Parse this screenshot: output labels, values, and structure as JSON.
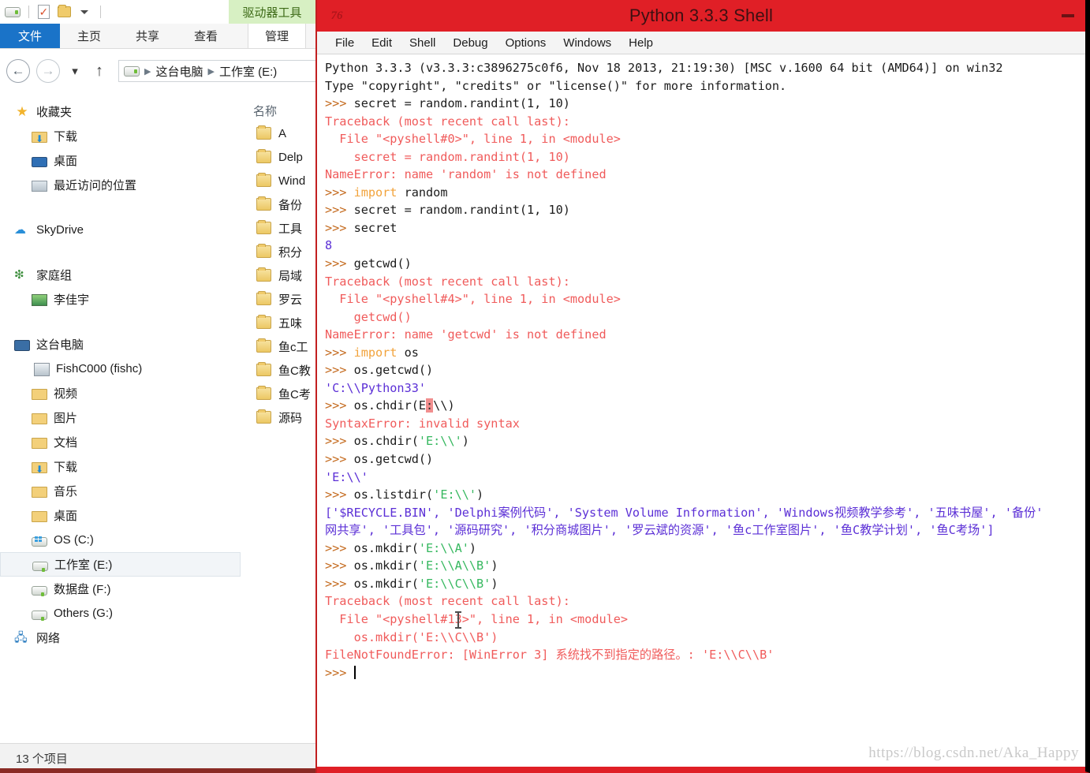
{
  "explorer": {
    "quick_access": {
      "drive_icon": "drive-icon",
      "new_doc_icon": "new-document-icon",
      "new_folder_icon": "new-folder-icon",
      "customize_icon": "chevron-down-icon"
    },
    "contextual_tab": "驱动器工具",
    "ribbon_tabs": [
      {
        "label": "文件",
        "active": true
      },
      {
        "label": "主页",
        "active": false
      },
      {
        "label": "共享",
        "active": false
      },
      {
        "label": "查看",
        "active": false
      },
      {
        "label": "管理",
        "active": false
      }
    ],
    "nav": {
      "back_icon": "back-arrow-icon",
      "forward_icon": "forward-arrow-icon",
      "history_icon": "chevron-down-icon",
      "up_icon": "up-arrow-icon",
      "breadcrumbs": [
        "这台电脑",
        "工作室 (E:)"
      ]
    },
    "tree": [
      {
        "label": "收藏夹",
        "icon": "star-icon",
        "level": 0,
        "selected": false
      },
      {
        "label": "下载",
        "icon": "folder-download-icon",
        "level": 1,
        "selected": false
      },
      {
        "label": "桌面",
        "icon": "desktop-icon",
        "level": 1,
        "selected": false
      },
      {
        "label": "最近访问的位置",
        "icon": "recent-places-icon",
        "level": 1,
        "selected": false
      },
      {
        "label": "SkyDrive",
        "icon": "cloud-icon",
        "level": 0,
        "selected": false
      },
      {
        "label": "家庭组",
        "icon": "homegroup-icon",
        "level": 0,
        "selected": false
      },
      {
        "label": "李佳宇",
        "icon": "user-icon",
        "level": 1,
        "selected": false
      },
      {
        "label": "这台电脑",
        "icon": "this-pc-icon",
        "level": 0,
        "selected": false
      },
      {
        "label": "FishC000 (fishc)",
        "icon": "device-icon",
        "level": 1,
        "selected": false
      },
      {
        "label": "视频",
        "icon": "folder-videos-icon",
        "level": 1,
        "selected": false
      },
      {
        "label": "图片",
        "icon": "folder-pictures-icon",
        "level": 1,
        "selected": false
      },
      {
        "label": "文档",
        "icon": "folder-documents-icon",
        "level": 1,
        "selected": false
      },
      {
        "label": "下载",
        "icon": "folder-download-icon",
        "level": 1,
        "selected": false
      },
      {
        "label": "音乐",
        "icon": "folder-music-icon",
        "level": 1,
        "selected": false
      },
      {
        "label": "桌面",
        "icon": "folder-desktop-icon",
        "level": 1,
        "selected": false
      },
      {
        "label": "OS (C:)",
        "icon": "os-drive-icon",
        "level": 1,
        "selected": false
      },
      {
        "label": "工作室 (E:)",
        "icon": "drive-icon",
        "level": 1,
        "selected": true
      },
      {
        "label": "数据盘 (F:)",
        "icon": "drive-icon",
        "level": 1,
        "selected": false
      },
      {
        "label": "Others (G:)",
        "icon": "drive-icon",
        "level": 1,
        "selected": false
      },
      {
        "label": "网络",
        "icon": "network-icon",
        "level": 0,
        "selected": false
      }
    ],
    "list": {
      "column_header": "名称",
      "rows": [
        {
          "name": "A",
          "icon": "folder-icon"
        },
        {
          "name": "Delp",
          "icon": "folder-icon"
        },
        {
          "name": "Wind",
          "icon": "folder-icon"
        },
        {
          "name": "备份",
          "icon": "folder-icon"
        },
        {
          "name": "工具",
          "icon": "folder-icon"
        },
        {
          "name": "积分",
          "icon": "folder-icon"
        },
        {
          "name": "局域",
          "icon": "folder-icon"
        },
        {
          "name": "罗云",
          "icon": "folder-icon"
        },
        {
          "name": "五味",
          "icon": "folder-icon"
        },
        {
          "name": "鱼c工",
          "icon": "folder-icon"
        },
        {
          "name": "鱼C教",
          "icon": "folder-icon"
        },
        {
          "name": "鱼C考",
          "icon": "folder-icon"
        },
        {
          "name": "源码",
          "icon": "folder-icon"
        }
      ]
    },
    "status": "13 个项目"
  },
  "shell": {
    "title": "Python 3.3.3 Shell",
    "logo_icon": "python-idle-icon",
    "minimize_icon": "minimize-icon",
    "titlebar_color": "#e01f26",
    "menus": [
      "File",
      "Edit",
      "Shell",
      "Debug",
      "Options",
      "Windows",
      "Help"
    ],
    "lines": [
      {
        "segments": [
          {
            "t": "Python 3.3.3 (v3.3.3:c3896275c0f6, Nov 18 2013, 21:19:30) [MSC v.1600 64 bit (AMD64)] on win32",
            "c": "out"
          }
        ]
      },
      {
        "segments": [
          {
            "t": "Type \"copyright\", \"credits\" or \"license()\" for more information.",
            "c": "out"
          }
        ]
      },
      {
        "segments": [
          {
            "t": ">>> ",
            "c": "prompt"
          },
          {
            "t": "secret = random.randint(1, 10)",
            "c": "out"
          }
        ]
      },
      {
        "segments": [
          {
            "t": "Traceback (most recent call last):",
            "c": "err"
          }
        ]
      },
      {
        "segments": [
          {
            "t": "  File \"<pyshell#0>\", line 1, in <module>",
            "c": "err"
          }
        ]
      },
      {
        "segments": [
          {
            "t": "    secret = random.randint(1, 10)",
            "c": "err"
          }
        ]
      },
      {
        "segments": [
          {
            "t": "NameError: name 'random' is not defined",
            "c": "err"
          }
        ]
      },
      {
        "segments": [
          {
            "t": ">>> ",
            "c": "prompt"
          },
          {
            "t": "import",
            "c": "kw"
          },
          {
            "t": " random",
            "c": "out"
          }
        ]
      },
      {
        "segments": [
          {
            "t": ">>> ",
            "c": "prompt"
          },
          {
            "t": "secret = random.randint(1, 10)",
            "c": "out"
          }
        ]
      },
      {
        "segments": [
          {
            "t": ">>> ",
            "c": "prompt"
          },
          {
            "t": "secret",
            "c": "out"
          }
        ]
      },
      {
        "segments": [
          {
            "t": "8",
            "c": "val"
          }
        ]
      },
      {
        "segments": [
          {
            "t": ">>> ",
            "c": "prompt"
          },
          {
            "t": "getcwd()",
            "c": "out"
          }
        ]
      },
      {
        "segments": [
          {
            "t": "Traceback (most recent call last):",
            "c": "err"
          }
        ]
      },
      {
        "segments": [
          {
            "t": "  File \"<pyshell#4>\", line 1, in <module>",
            "c": "err"
          }
        ]
      },
      {
        "segments": [
          {
            "t": "    getcwd()",
            "c": "err"
          }
        ]
      },
      {
        "segments": [
          {
            "t": "NameError: name 'getcwd' is not defined",
            "c": "err"
          }
        ]
      },
      {
        "segments": [
          {
            "t": ">>> ",
            "c": "prompt"
          },
          {
            "t": "import",
            "c": "kw"
          },
          {
            "t": " os",
            "c": "out"
          }
        ]
      },
      {
        "segments": [
          {
            "t": ">>> ",
            "c": "prompt"
          },
          {
            "t": "os.getcwd()",
            "c": "out"
          }
        ]
      },
      {
        "segments": [
          {
            "t": "'C:\\\\Python33'",
            "c": "val"
          }
        ]
      },
      {
        "segments": [
          {
            "t": ">>> ",
            "c": "prompt"
          },
          {
            "t": "os.chdir(E",
            "c": "out"
          },
          {
            "t": ":",
            "c": "sel"
          },
          {
            "t": "\\\\)",
            "c": "out"
          }
        ]
      },
      {
        "segments": [
          {
            "t": "SyntaxError: invalid syntax",
            "c": "err"
          }
        ]
      },
      {
        "segments": [
          {
            "t": ">>> ",
            "c": "prompt"
          },
          {
            "t": "os.chdir(",
            "c": "out"
          },
          {
            "t": "'E:\\\\'",
            "c": "str"
          },
          {
            "t": ")",
            "c": "out"
          }
        ]
      },
      {
        "segments": [
          {
            "t": ">>> ",
            "c": "prompt"
          },
          {
            "t": "os.getcwd()",
            "c": "out"
          }
        ]
      },
      {
        "segments": [
          {
            "t": "'E:\\\\'",
            "c": "val"
          }
        ]
      },
      {
        "segments": [
          {
            "t": ">>> ",
            "c": "prompt"
          },
          {
            "t": "os.listdir(",
            "c": "out"
          },
          {
            "t": "'E:\\\\'",
            "c": "str"
          },
          {
            "t": ")",
            "c": "out"
          }
        ]
      },
      {
        "segments": [
          {
            "t": "['$RECYCLE.BIN', 'Delphi案例代码', 'System Volume Information', 'Windows视频教学参考', '五味书屋', '备份'",
            "c": "val"
          }
        ]
      },
      {
        "segments": [
          {
            "t": "网共享', '工具包', '源码研究', '积分商城图片', '罗云斌的资源', '鱼c工作室图片', '鱼C教学计划', '鱼C考场']",
            "c": "val"
          }
        ]
      },
      {
        "segments": [
          {
            "t": ">>> ",
            "c": "prompt"
          },
          {
            "t": "os.mkdir(",
            "c": "out"
          },
          {
            "t": "'E:\\\\A'",
            "c": "str"
          },
          {
            "t": ")",
            "c": "out"
          }
        ]
      },
      {
        "segments": [
          {
            "t": ">>> ",
            "c": "prompt"
          },
          {
            "t": "os.mkdir(",
            "c": "out"
          },
          {
            "t": "'E:\\\\A\\\\B'",
            "c": "str"
          },
          {
            "t": ")",
            "c": "out"
          }
        ]
      },
      {
        "segments": [
          {
            "t": ">>> ",
            "c": "prompt"
          },
          {
            "t": "os.mkdir(",
            "c": "out"
          },
          {
            "t": "'E:\\\\C\\\\B'",
            "c": "str"
          },
          {
            "t": ")",
            "c": "out"
          }
        ]
      },
      {
        "segments": [
          {
            "t": "Traceback (most recent call last):",
            "c": "err"
          }
        ]
      },
      {
        "segments": [
          {
            "t": "  File \"<pyshell#13>\", line 1, in <module>",
            "c": "err"
          }
        ]
      },
      {
        "segments": [
          {
            "t": "    os.mkdir('E:\\\\C\\\\B')",
            "c": "err"
          }
        ]
      },
      {
        "segments": [
          {
            "t": "FileNotFoundError: [WinError 3] 系统找不到指定的路径。: 'E:\\\\C\\\\B'",
            "c": "err"
          }
        ]
      },
      {
        "segments": [
          {
            "t": ">>> ",
            "c": "prompt"
          },
          {
            "t": "",
            "c": "caret"
          }
        ]
      }
    ]
  },
  "watermark": "https://blog.csdn.net/Aka_Happy"
}
